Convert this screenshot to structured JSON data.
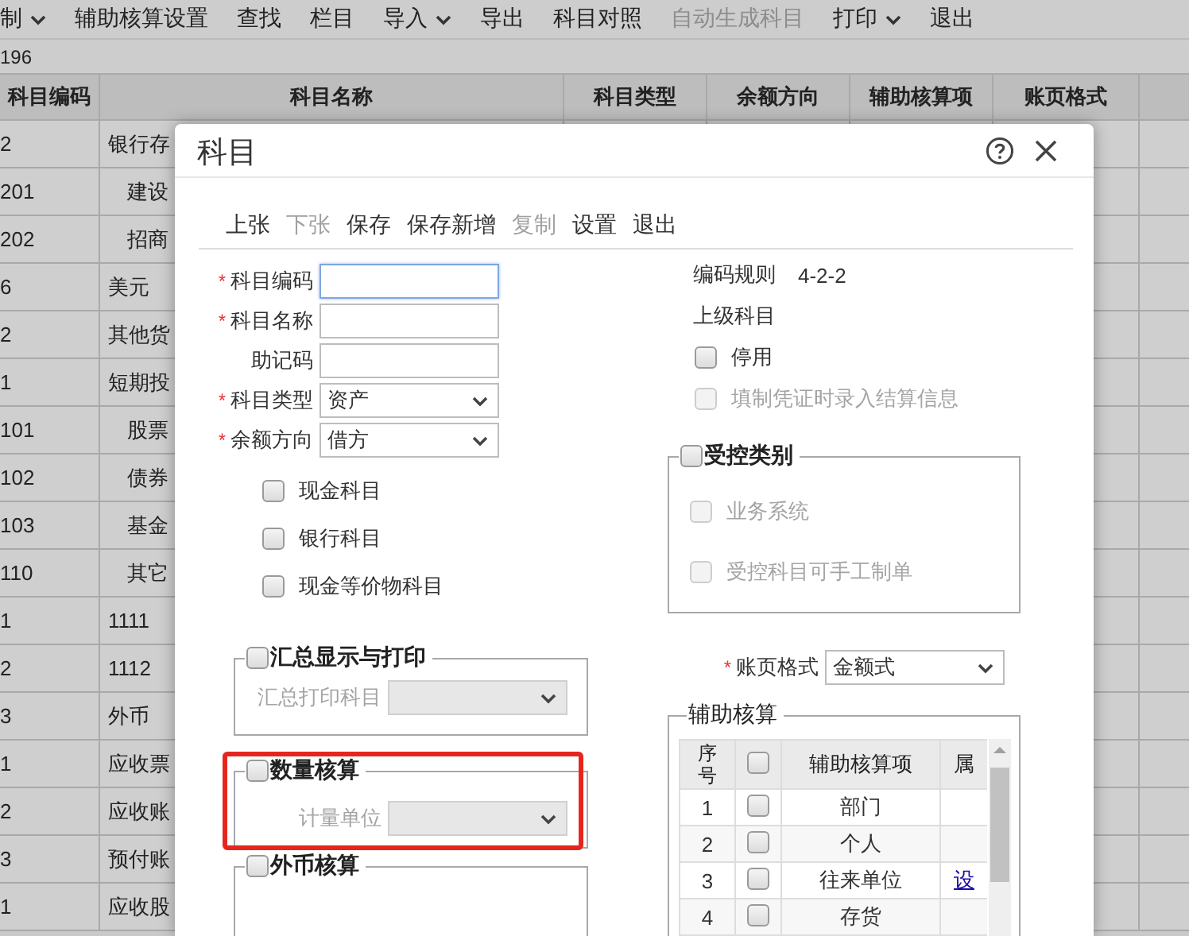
{
  "toolbar": [
    {
      "label": "制",
      "caret": true,
      "disabled": false
    },
    {
      "label": "辅助核算设置",
      "caret": false,
      "disabled": false
    },
    {
      "label": "查找",
      "caret": false,
      "disabled": false
    },
    {
      "label": "栏目",
      "caret": false,
      "disabled": false
    },
    {
      "label": "导入",
      "caret": true,
      "disabled": false
    },
    {
      "label": "导出",
      "caret": false,
      "disabled": false
    },
    {
      "label": "科目对照",
      "caret": false,
      "disabled": false
    },
    {
      "label": "自动生成科目",
      "caret": false,
      "disabled": true
    },
    {
      "label": "打印",
      "caret": true,
      "disabled": false
    },
    {
      "label": "退出",
      "caret": false,
      "disabled": false
    }
  ],
  "record_count": "196",
  "table": {
    "columns": [
      "科目编码",
      "科目名称",
      "科目类型",
      "余额方向",
      "辅助核算项",
      "账页格式"
    ],
    "rows": [
      {
        "code": "2",
        "name": "银行存",
        "children": [
          {
            "code": "201",
            "name": "建设"
          },
          {
            "code": "202",
            "name": "招商"
          }
        ]
      },
      {
        "code": "6",
        "name": "美元"
      },
      {
        "code": "2",
        "name": "其他货"
      },
      {
        "code": "1",
        "name": "短期投",
        "children": [
          {
            "code": "101",
            "name": "股票"
          },
          {
            "code": "102",
            "name": "债券"
          },
          {
            "code": "103",
            "name": "基金"
          },
          {
            "code": "110",
            "name": "其它"
          }
        ]
      },
      {
        "code": "1",
        "name": "1111"
      },
      {
        "code": "2",
        "name": "1112"
      },
      {
        "code": "3",
        "name": "外币"
      },
      {
        "code": "1",
        "name": "应收票"
      },
      {
        "code": "2",
        "name": "应收账"
      },
      {
        "code": "3",
        "name": "预付账"
      },
      {
        "code": "1",
        "name": "应收股"
      }
    ]
  },
  "dialog": {
    "title": "科目",
    "toolbar": [
      {
        "label": "上张",
        "disabled": false
      },
      {
        "label": "下张",
        "disabled": true
      },
      {
        "label": "保存",
        "disabled": false
      },
      {
        "label": "保存新增",
        "disabled": false
      },
      {
        "label": "复制",
        "disabled": true
      },
      {
        "label": "设置",
        "disabled": false
      },
      {
        "label": "退出",
        "disabled": false
      }
    ],
    "fields": [
      {
        "kind": "text",
        "label": "科目编码",
        "required_mark": "*",
        "focused": true
      },
      {
        "kind": "text",
        "label": "科目名称",
        "required_mark": "*",
        "focused": false
      },
      {
        "kind": "text",
        "label": "助记码",
        "focused": false
      },
      {
        "kind": "select",
        "label": "科目类型",
        "required_mark": "*",
        "focused": false,
        "value": "资产"
      },
      {
        "kind": "select",
        "label": "余额方向",
        "required_mark": "*",
        "focused": false,
        "value": "借方"
      }
    ],
    "options": [
      {
        "label": "现金科目",
        "checked": false
      },
      {
        "label": "银行科目",
        "checked": false
      },
      {
        "label": "现金等价物科目",
        "checked": false
      }
    ],
    "groups": [
      {
        "title": "汇总显示与打印",
        "checked": false,
        "field_label": "汇总打印科目",
        "highlighted": false
      },
      {
        "title": "数量核算",
        "checked": false,
        "field_label": "计量单位",
        "highlighted": true
      },
      {
        "title": "外币核算",
        "checked": false,
        "highlighted": false
      }
    ],
    "coding_rule": {
      "label": "编码规则",
      "value": "4-2-2"
    },
    "parent_label": "上级科目",
    "flags": [
      {
        "label": "停用",
        "checked": false,
        "disabled": false
      },
      {
        "label": "填制凭证时录入结算信息",
        "checked": false,
        "disabled": true
      }
    ],
    "controlled": {
      "title": "受控类别",
      "checked": false,
      "items": [
        {
          "label": "业务系统",
          "checked": false,
          "disabled": true
        },
        {
          "label": "受控科目可手工制单",
          "checked": false,
          "disabled": true
        }
      ]
    },
    "ledger_format": {
      "label": "账页格式",
      "required_mark": "*",
      "value": "金额式"
    },
    "auxiliary": {
      "title": "辅助核算",
      "columns": [
        "序号",
        "辅助核算项",
        "属"
      ],
      "header_checked": false,
      "rows": [
        {
          "no": "1",
          "name": "部门",
          "checked": false
        },
        {
          "no": "2",
          "name": "个人",
          "checked": false
        },
        {
          "no": "3",
          "name": "往来单位",
          "checked": false,
          "link": "设"
        },
        {
          "no": "4",
          "name": "存货",
          "checked": false
        }
      ]
    }
  }
}
